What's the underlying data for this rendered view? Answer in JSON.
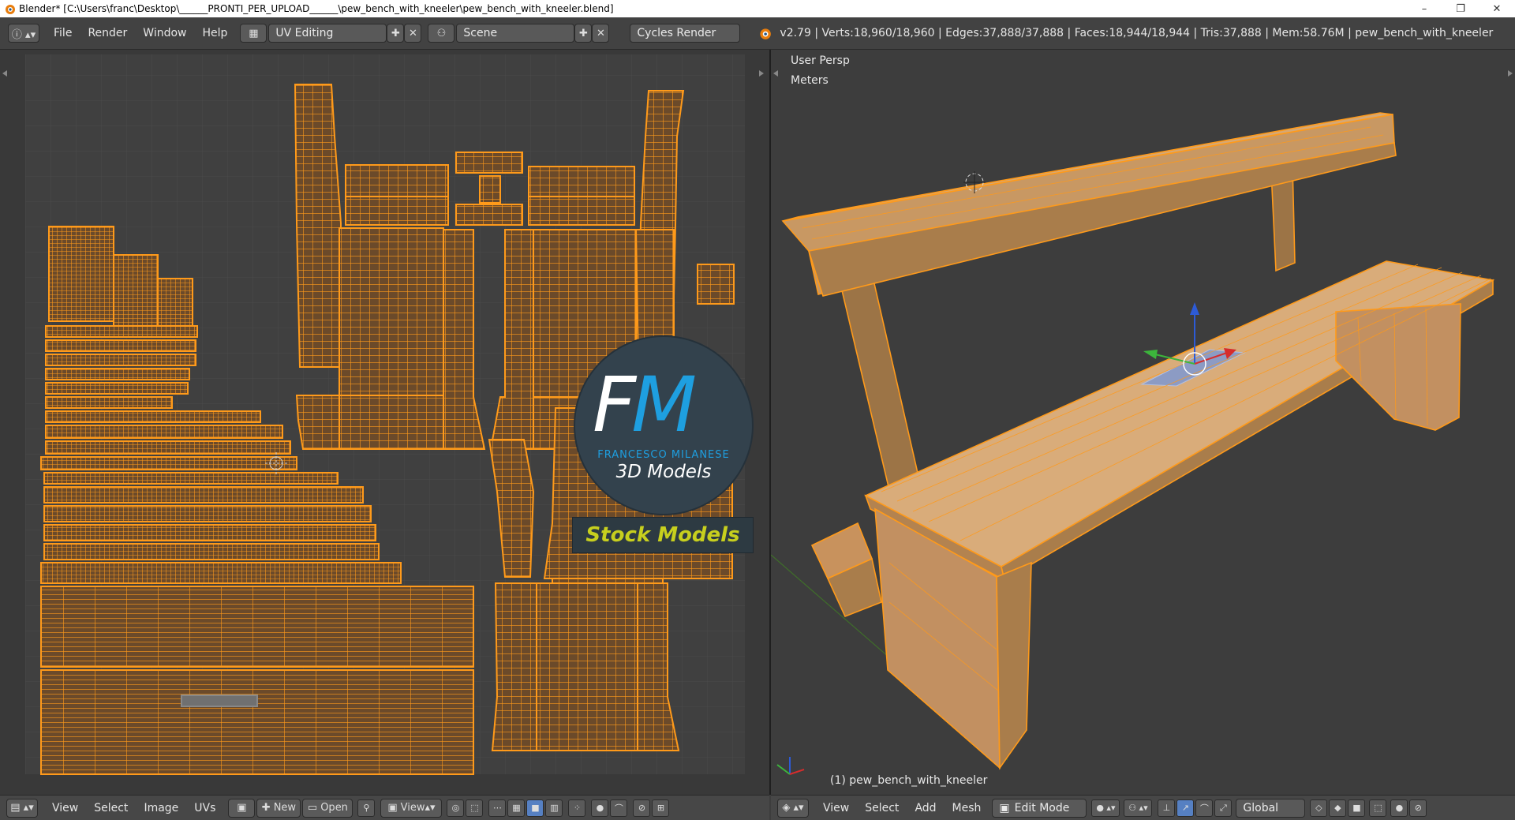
{
  "titlebar": {
    "title": "Blender* [C:\\Users\\franc\\Desktop\\______PRONTI_PER_UPLOAD______\\pew_bench_with_kneeler\\pew_bench_with_kneeler.blend]",
    "minimize": "–",
    "maximize": "❐",
    "close": "✕"
  },
  "info_header": {
    "menus": [
      "File",
      "Render",
      "Window",
      "Help"
    ],
    "screen_layout": "UV Editing",
    "scene": "Scene",
    "render_engine": "Cycles Render",
    "stats": "v2.79 | Verts:18,960/18,960 | Edges:37,888/37,888 | Faces:18,944/18,944 | Tris:37,888 | Mem:58.76M | pew_bench_with_kneeler"
  },
  "viewport": {
    "view_name": "User Persp",
    "units": "Meters",
    "object_label": "(1) pew_bench_with_kneeler"
  },
  "watermark": {
    "initial_f": "F",
    "initial_m": "M",
    "author": "FRANCESCO MILANESE",
    "subtitle": "3D Models",
    "banner": "Stock Models"
  },
  "uv_footer": {
    "menus": [
      "View",
      "Select",
      "Image",
      "UVs"
    ],
    "new_label": "New",
    "open_label": "Open",
    "view_label": "View"
  },
  "vp_footer": {
    "menus": [
      "View",
      "Select",
      "Add",
      "Mesh"
    ],
    "mode": "Edit Mode",
    "orientation": "Global"
  },
  "colors": {
    "wire": "#ff9a1a",
    "face": "#6b4a2a",
    "accent": "#1e9fe0",
    "banner": "#c7cf1e"
  }
}
